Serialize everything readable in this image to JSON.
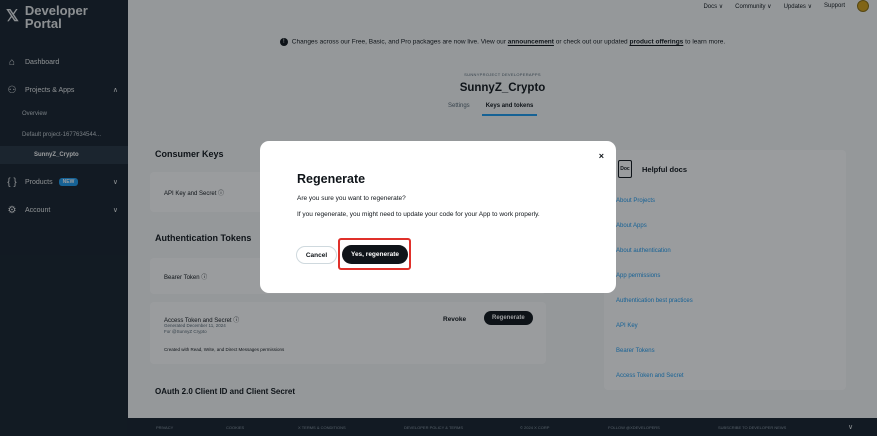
{
  "sidebar": {
    "brand_title": "Developer\nPortal",
    "brand_line1": "Developer",
    "brand_line2": "Portal",
    "items": [
      {
        "label": "Dashboard"
      },
      {
        "label": "Projects & Apps"
      },
      {
        "label": "Overview"
      },
      {
        "label": "Default project-1677634544..."
      },
      {
        "label": "SunnyZ_Crypto"
      },
      {
        "label": "Products"
      },
      {
        "label": "Account"
      }
    ],
    "new_badge": "NEW"
  },
  "topnav": {
    "docs": "Docs ∨",
    "community": "Community ∨",
    "updates": "Updates ∨",
    "support": "Support"
  },
  "announcement": {
    "text_before": "Changes across our Free, Basic, and Pro packages are now live. View our ",
    "link1": "announcement",
    "text_middle": " or check out our updated ",
    "link2": "product offerings",
    "text_after": " to learn more."
  },
  "app": {
    "project_label": "SUNNYPROJECT DEVELOPERAPPS",
    "name": "SunnyZ_Crypto",
    "tabs": [
      "Settings",
      "Keys and tokens"
    ]
  },
  "consumer_keys": {
    "title": "Consumer Keys",
    "api_key_label": "API Key and Secret ⓘ"
  },
  "auth_tokens": {
    "title": "Authentication Tokens",
    "bearer_label": "Bearer Token ⓘ",
    "access_label": "Access Token and Secret ⓘ",
    "access_sub1": "Generated December 11, 2024",
    "access_sub2": "For @SunnyZ Crypto",
    "created_with": "Created with Read, Write, and Direct Messages permissions",
    "revoke": "Revoke",
    "regenerate": "Regenerate"
  },
  "oauth": {
    "title": "OAuth 2.0 Client ID and Client Secret"
  },
  "help": {
    "title": "Helpful docs",
    "icon_text": "Doc",
    "links": [
      "About Projects",
      "About Apps",
      "About authentication",
      "App permissions",
      "Authentication best practices",
      "API Key",
      "Bearer Tokens",
      "Access Token and Secret"
    ]
  },
  "footer": {
    "items": [
      "PRIVACY",
      "COOKIES",
      "X TERMS & CONDITIONS",
      "DEVELOPER POLICY & TERMS",
      "© 2024 X CORP",
      "FOLLOW @XDEVELOPERS",
      "SUBSCRIBE TO DEVELOPER NEWS"
    ],
    "chevron": "∨"
  },
  "modal": {
    "title": "Regenerate",
    "question": "Are you sure you want to regenerate?",
    "body": "If you regenerate, you might need to update your code for your App to work properly.",
    "cancel": "Cancel",
    "confirm": "Yes, regenerate",
    "close": "×"
  },
  "colors": {
    "accent": "#1d9bf0",
    "sidebar_bg": "#15202b",
    "highlight": "#e0302a"
  }
}
